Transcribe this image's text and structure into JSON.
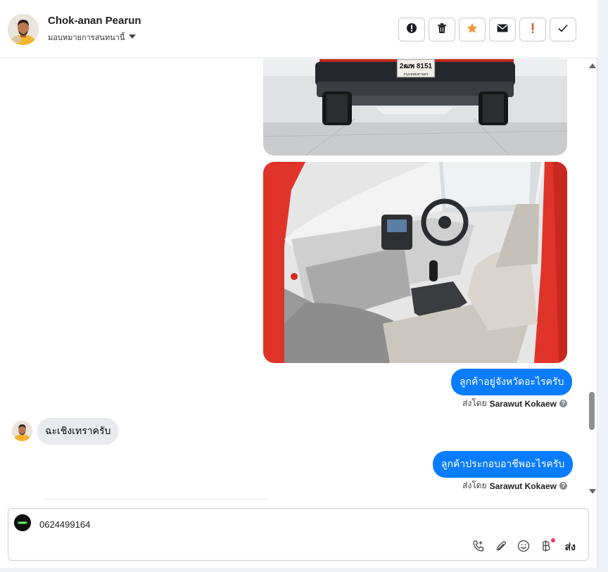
{
  "header": {
    "contact_name": "Chok-anan Pearun",
    "assign_label": "มอบหมายการสนทนานี้",
    "actions": [
      {
        "name": "alert-circle-icon"
      },
      {
        "name": "trash-icon"
      },
      {
        "name": "star-icon"
      },
      {
        "name": "envelope-icon"
      },
      {
        "name": "exclamation-icon"
      },
      {
        "name": "check-icon"
      }
    ]
  },
  "vehicle_image": {
    "plate_line1": "2ฒพ 8151",
    "plate_line2": "กรุงเทพมหานคร"
  },
  "messages": [
    {
      "text": "ลูกค้าอยู่จังหวัดอะไรครับ",
      "sent_by_prefix": "ส่งโดย",
      "sent_by_name": "Sarawut Kokaew"
    },
    {
      "text": "ฉะเชิงเทราครับ"
    },
    {
      "text": "ลูกค้าประกอบอาชีพอะไรครับ",
      "sent_by_prefix": "ส่งโดย",
      "sent_by_name": "Sarawut Kokaew"
    }
  ],
  "composer": {
    "text": "0624499164",
    "send_label": "ส่ง"
  },
  "colors": {
    "outgoing_bubble": "#0a7cff",
    "incoming_bubble": "#e9eaed",
    "star": "#f7923a",
    "exclamation": "#e0541f"
  }
}
